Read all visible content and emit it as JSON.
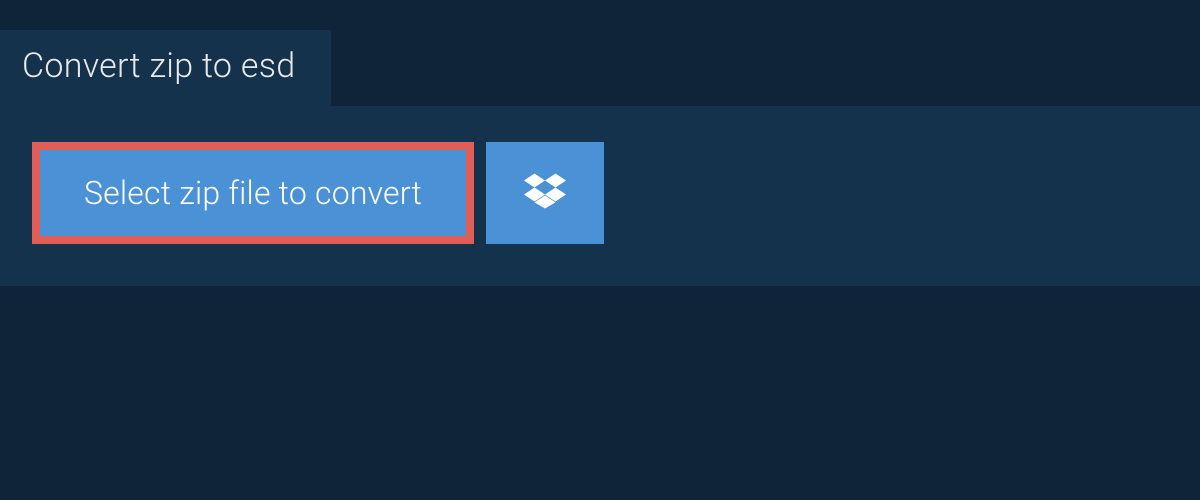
{
  "tab": {
    "title": "Convert zip to esd"
  },
  "actions": {
    "select_label": "Select zip file to convert"
  }
}
